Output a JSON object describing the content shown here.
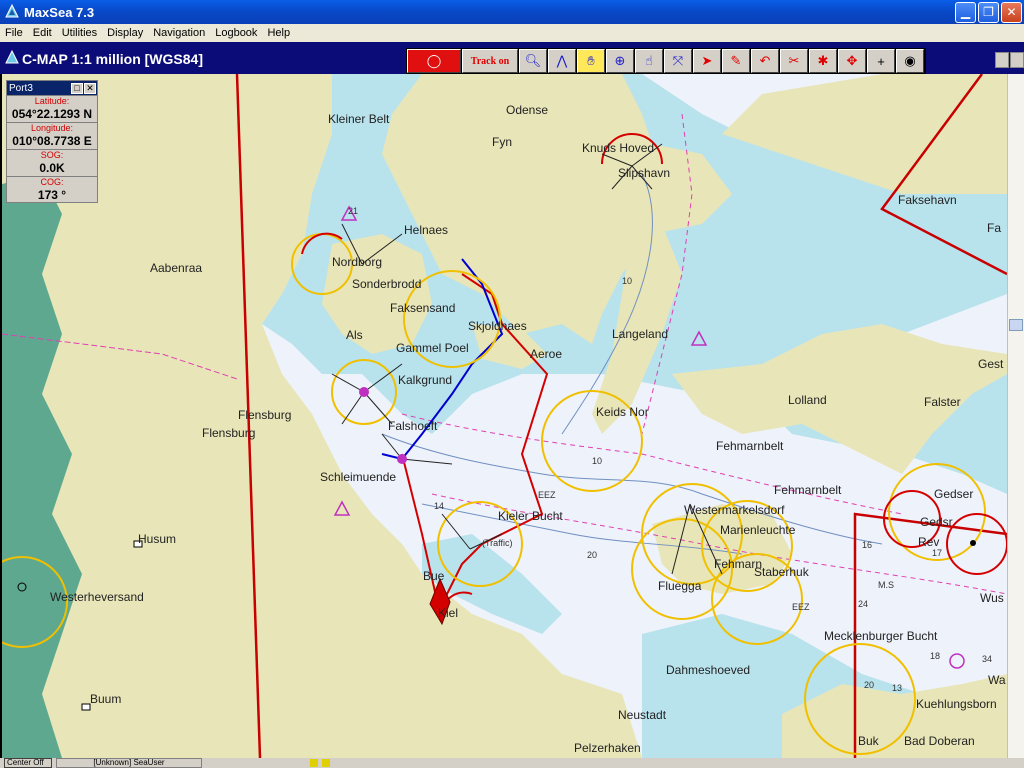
{
  "window": {
    "title": "MaxSea 7.3"
  },
  "menu": [
    "File",
    "Edit",
    "Utilities",
    "Display",
    "Navigation",
    "Logbook",
    "Help"
  ],
  "chart_header": {
    "label": "C-MAP  1:1 million [WGS84]"
  },
  "toolbar": {
    "track_label": "Track on"
  },
  "panel": {
    "title": "Port3",
    "latitude_label": "Latitude:",
    "latitude_value": "054°22.1293 N",
    "longitude_label": "Longitude:",
    "longitude_value": "010°08.7738 E",
    "sog_label": "SOG:",
    "sog_value": "0.0K",
    "cog_label": "COG:",
    "cog_value": "173 °"
  },
  "places": {
    "kleiner_belt": "Kleiner Belt",
    "odense": "Odense",
    "fyn": "Fyn",
    "knuds_hoved": "Knuds Hoved",
    "slipshavn": "Slipshavn",
    "faksehavn": "Faksehavn",
    "fa": "Fa",
    "helnaes": "Helnaes",
    "nordborg": "Nordborg",
    "aabenraa": "Aabenraa",
    "faksensand": "Faksensand",
    "sonderbrodd": "Sonderbrodd",
    "skjoldnaes": "Skjoldnaes",
    "aeroe": "Aeroe",
    "langeland": "Langeland",
    "als": "Als",
    "gammel_poel": "Gammel Poel",
    "kalkgrund": "Kalkgrund",
    "flensburg1": "Flensburg",
    "flensburg2": "Flensburg",
    "keids_nor": "Keids Nor",
    "lolland": "Lolland",
    "falster": "Falster",
    "gest": "Gest",
    "falshoeft": "Falshoeft",
    "fehmarnbelt1": "Fehmarnbelt",
    "fehmarnbelt2": "Fehmarnbelt",
    "schleimuende": "Schleimuende",
    "gedser": "Gedser",
    "gedsr": "Gedsr",
    "rev": "Rev",
    "kieler_bucht": "Kieler Bucht",
    "westermarkelsdorf": "Westermarkelsdorf",
    "marienleuchte": "Marienleuchte",
    "husum": "Husum",
    "traffic": "(Traffic)",
    "fehmarn": "Fehmarn",
    "staberhuk": "Staberhuk",
    "wus": "Wus",
    "westerheversand": "Westerheversand",
    "bue": "Bue",
    "kiel": "Kiel",
    "fluegga": "Fluegga",
    "mecklenburger_bucht": "Mecklenburger Bucht",
    "dahmeshoeved": "Dahmeshoeved",
    "buum": "Buum",
    "neustadt": "Neustadt",
    "kuehlungsborn": "Kuehlungsborn",
    "pelzerhaken": "Pelzerhaken",
    "buk": "Buk",
    "bad_doberan": "Bad Doberan",
    "wa": "Wa"
  },
  "soundings": {
    "d21": "21",
    "d14": "14",
    "d20a": "20",
    "d20b": "20",
    "d10a": "10",
    "d16": "16",
    "d24": "24",
    "d13": "13",
    "d18": "18",
    "d34": "34",
    "d171": "17",
    "d10b": "10",
    "eez1": "EEZ",
    "eez2": "EEZ",
    "ms": "M.S"
  },
  "status": {
    "left": "Center Off",
    "user": "[Unknown] SeaUser"
  },
  "colors": {
    "land": "#e8e6b8",
    "shallow": "#b8e2ec",
    "deep": "#eef2fb",
    "danish_land": "#5fa890",
    "route": "#d40000",
    "track": "#0000d0",
    "light_ring": "#f0c000",
    "lane": "#e040b0"
  }
}
